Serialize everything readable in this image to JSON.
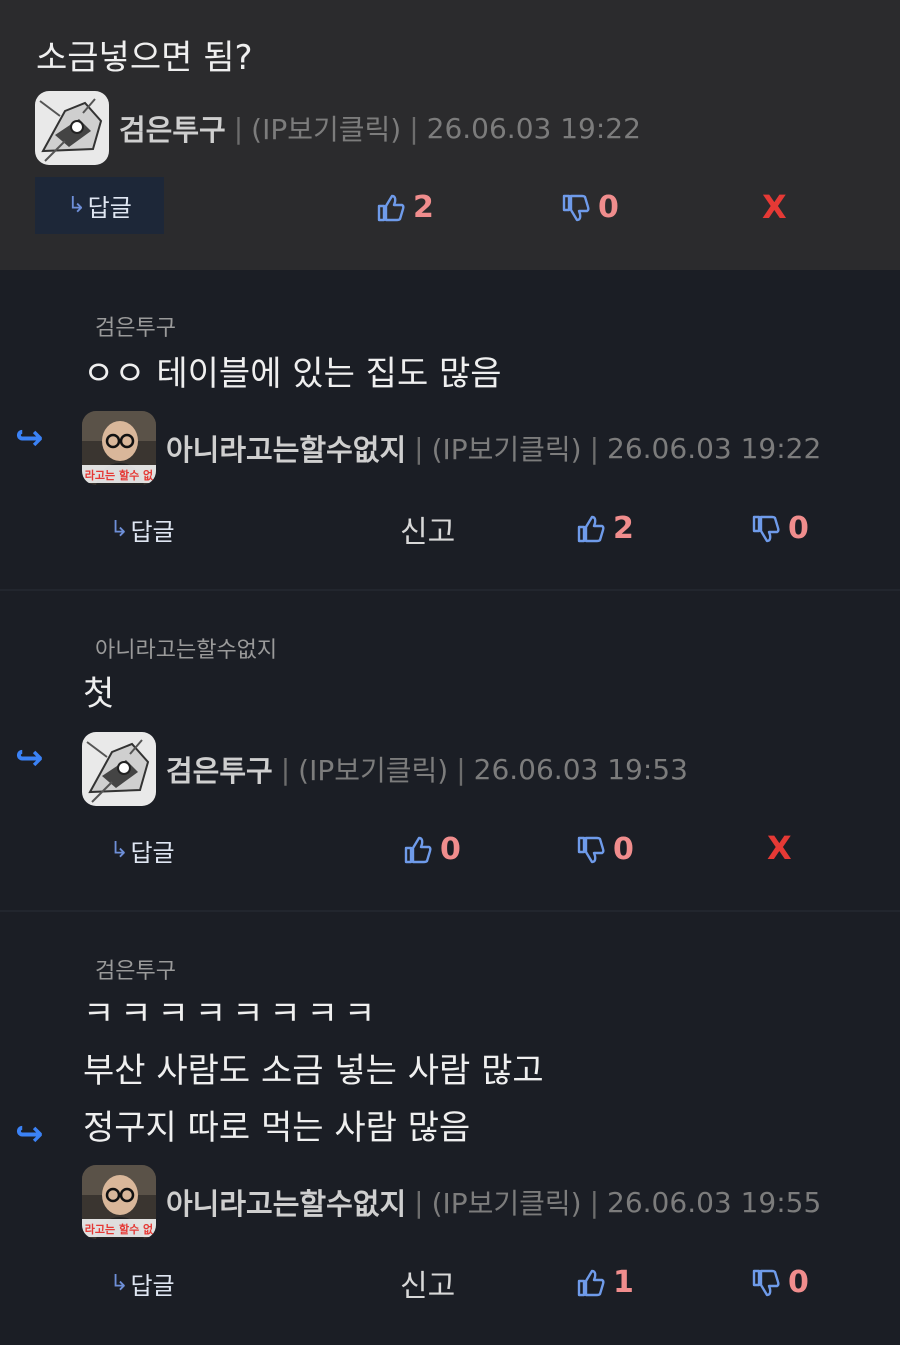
{
  "top": {
    "text": "소금넣으면 됨?",
    "author": "검은투구",
    "ip": "(IP보기클릭)",
    "date": "26.06.03 19:22",
    "reply_label": "답글",
    "up": "2",
    "down": "0",
    "delete": "X"
  },
  "c1": {
    "mention": "검은투구",
    "text": "ㅇㅇ 테이블에 있는 집도 많음",
    "author": "아니라고는할수없지",
    "ip": "(IP보기클릭)",
    "date": "26.06.03 19:22",
    "reply_label": "답글",
    "report": "신고",
    "up": "2",
    "down": "0"
  },
  "c2": {
    "mention": "아니라고는할수없지",
    "text": "첫",
    "author": "검은투구",
    "ip": "(IP보기클릭)",
    "date": "26.06.03 19:53",
    "reply_label": "답글",
    "up": "0",
    "down": "0",
    "delete": "X"
  },
  "c3": {
    "mention": "검은투구",
    "line1": "ㅋㅋㅋㅋㅋㅋㅋㅋ",
    "line2": "부산 사람도 소금 넣는 사람 많고",
    "line3": "정구지 따로 먹는 사람 많음",
    "author": "아니라고는할수없지",
    "ip": "(IP보기클릭)",
    "date": "26.06.03 19:55",
    "reply_label": "답글",
    "report": "신고",
    "up": "1",
    "down": "0"
  },
  "sep_char": "|",
  "reply_arrow": "↪",
  "small_arrow": "↳",
  "avatar_caption": "라고는 할수 없"
}
